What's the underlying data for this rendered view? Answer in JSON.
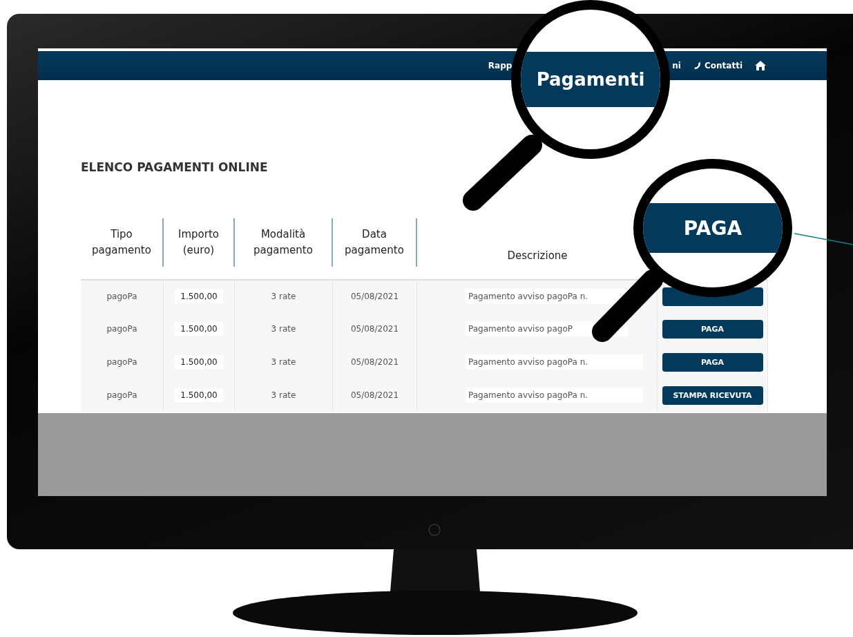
{
  "nav": {
    "items": [
      {
        "kind": "text",
        "label": "Rapp"
      },
      {
        "kind": "text",
        "label": "ni"
      },
      {
        "kind": "phone",
        "label": "Contatti"
      },
      {
        "kind": "home"
      }
    ]
  },
  "title": "ELENCO PAGAMENTI ONLINE",
  "table": {
    "columns": [
      "Tipo pagamento",
      "Importo (euro)",
      "Modalità pagamento",
      "Data pagamento",
      "Descrizione"
    ],
    "rows": [
      {
        "tipo": "pagoPa",
        "importo": "1.500,00",
        "modalita": "3 rate",
        "data": "05/08/2021",
        "descrizione": "Pagamento avviso pagoPa n.",
        "action": {
          "kind": "primary"
        }
      },
      {
        "tipo": "pagoPa",
        "importo": "1.500,00",
        "modalita": "3 rate",
        "data": "05/08/2021",
        "descrizione": "Pagamento avviso pagoP",
        "action": {
          "kind": "primary",
          "label": "PAGA"
        }
      },
      {
        "tipo": "pagoPa",
        "importo": "1.500,00",
        "modalita": "3 rate",
        "data": "05/08/2021",
        "descrizione": "Pagamento avviso pagoPa n.",
        "action": {
          "kind": "primary",
          "label": "PAGA"
        }
      },
      {
        "tipo": "pagoPa",
        "importo": "1.500,00",
        "modalita": "3 rate",
        "data": "05/08/2021",
        "descrizione": "Pagamento avviso pagoPa n.",
        "action": {
          "kind": "primary",
          "label": "STAMPA RICEVUTA"
        }
      }
    ]
  },
  "magnifiers": [
    {
      "text": "Pagamenti"
    },
    {
      "text": "PAGA"
    }
  ]
}
